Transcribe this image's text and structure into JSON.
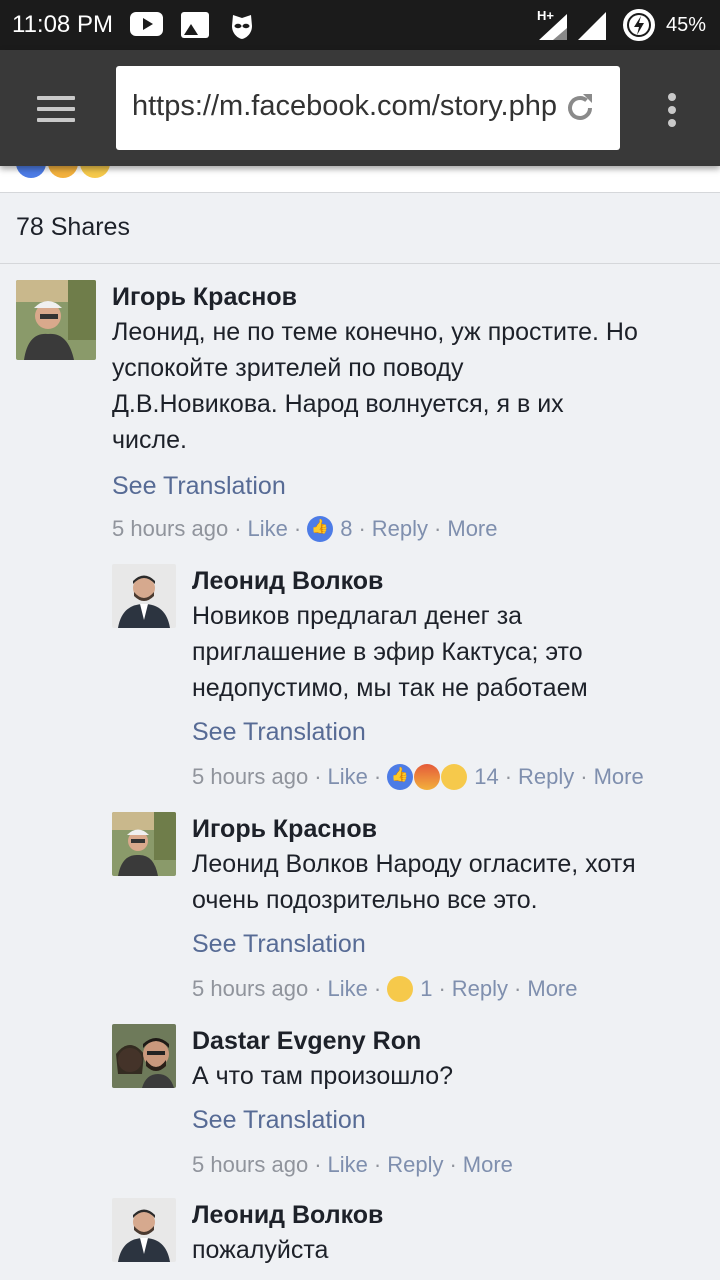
{
  "status_bar": {
    "time": "11:08 PM",
    "network": "H+",
    "battery": "45%",
    "icons": [
      "youtube-icon",
      "image-icon",
      "incognito-mask-icon",
      "signal-icon",
      "battery-charging-icon"
    ]
  },
  "browser": {
    "url": "https://m.facebook.com/story.php",
    "icons": [
      "menu-icon",
      "reload-icon",
      "more-vert-icon"
    ]
  },
  "post": {
    "shares": "78 Shares"
  },
  "comments": [
    {
      "author": "Игорь Краснов",
      "lines": [
        "Леонид, не по теме конечно, уж простите. Но",
        "успокойте зрителей по поводу",
        "Д.В.Новикова. Народ волнуется, я в их",
        "числе."
      ],
      "see_translation": "See Translation",
      "time": "5 hours ago",
      "like": "Like",
      "reaction_count": "8",
      "reply": "Reply",
      "more": "More"
    },
    {
      "author": "Леонид Волков",
      "lines": [
        "Новиков предлагал денег за",
        "приглашение в эфир Кактуса; это",
        "недопустимо, мы так не работаем"
      ],
      "see_translation": "See Translation",
      "time": "5 hours ago",
      "like": "Like",
      "reaction_count": "14",
      "reply": "Reply",
      "more": "More"
    },
    {
      "author": "Игорь Краснов",
      "lines": [
        "Леонид Волков Народу огласите, хотя",
        "очень подозрительно все это."
      ],
      "see_translation": "See Translation",
      "time": "5 hours ago",
      "like": "Like",
      "reaction_count": "1",
      "reply": "Reply",
      "more": "More"
    },
    {
      "author": "Dastar Evgeny Ron",
      "lines": [
        "А что там произошло?"
      ],
      "see_translation": "See Translation",
      "time": "5 hours ago",
      "like": "Like",
      "reply": "Reply",
      "more": "More"
    },
    {
      "author": "Леонид Волков",
      "lines": [
        "пожалуйста"
      ]
    }
  ]
}
